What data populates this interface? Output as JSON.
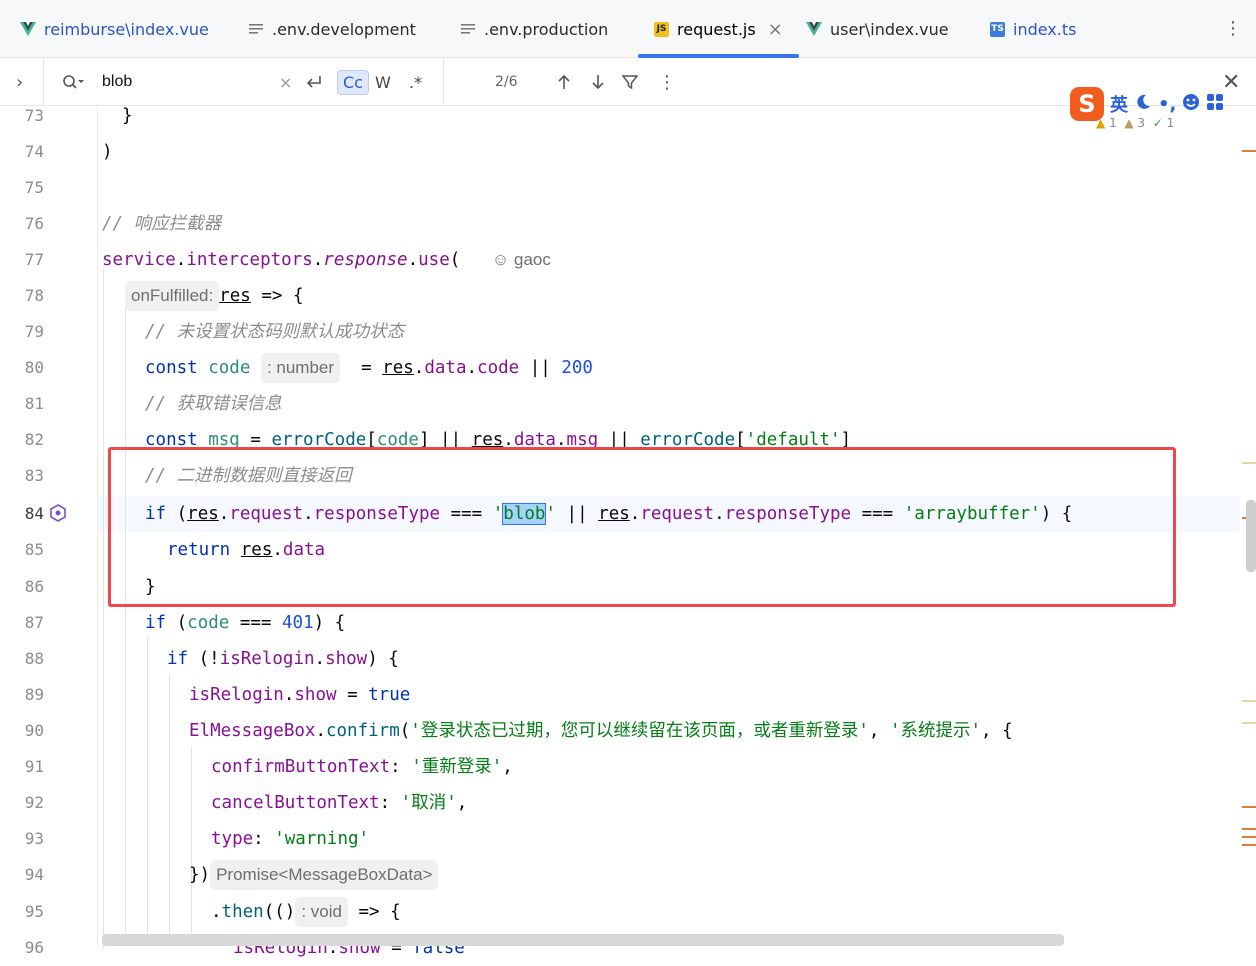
{
  "tabs": [
    {
      "label": "reimburse\\index.vue",
      "icon": "vue-icon",
      "active": false
    },
    {
      "label": ".env.development",
      "icon": "text-file-icon",
      "active": false
    },
    {
      "label": ".env.production",
      "icon": "text-file-icon",
      "active": false
    },
    {
      "label": "request.js",
      "icon": "js-file-icon",
      "active": true
    },
    {
      "label": "user\\index.vue",
      "icon": "vue-icon",
      "active": false
    },
    {
      "label": "index.ts",
      "icon": "ts-file-icon",
      "active": false
    }
  ],
  "js_badge": "JS",
  "ts_badge": "TS",
  "find": {
    "value": "blob",
    "match_count": "2/6",
    "opt_case": "Cc",
    "opt_word": "W",
    "opt_regex": ".*"
  },
  "ime": {
    "logo": "S",
    "mode": "英",
    "symbols": "•,"
  },
  "inspections": {
    "warn": "1",
    "weak": "3",
    "typo": "1"
  },
  "gutter_lines": [
    "73",
    "74",
    "75",
    "76",
    "77",
    "78",
    "79",
    "80",
    "81",
    "82",
    "83",
    "84",
    "85",
    "86",
    "87",
    "88",
    "89",
    "90",
    "91",
    "92",
    "93",
    "94",
    "95",
    "96"
  ],
  "code": {
    "l73": "}",
    "l74": ")",
    "l76": "// 响应拦截器",
    "l77_obj": "service",
    "l77_a": "interceptors",
    "l77_b": "response",
    "l77_c": "use",
    "l77_author": "gaoc",
    "l78_hint": "onFulfilled:",
    "l78_param": "res",
    "l78_arrow": " => {",
    "l79": "// 未设置状态码则默认成功状态",
    "l80_const": "const",
    "l80_var": "code",
    "l80_hint": ": number",
    "l80_res": "res",
    "l80_data": "data",
    "l80_code": "code",
    "l80_num": "200",
    "l81": "// 获取错误信息",
    "l82_const": "const",
    "l82_var": "msg",
    "l82_fn": "errorCode",
    "l82_code": "code",
    "l82_res": "res",
    "l82_data": "data",
    "l82_msg": "msg",
    "l82_fn2": "errorCode",
    "l82_str": "'default'",
    "l83": "// 二进制数据则直接返回",
    "l84_if": "if",
    "l84_res": "res",
    "l84_request": "request",
    "l84_rt": "responseType",
    "l84_q1": "'",
    "l84_blob": "blob",
    "l84_q2": "'",
    "l84_res2": "res",
    "l84_request2": "request",
    "l84_rt2": "responseType",
    "l84_str2": "'arraybuffer'",
    "l85_ret": "return",
    "l85_res": "res",
    "l85_data": "data",
    "l86": "}",
    "l87_if": "if",
    "l87_code": "code",
    "l87_num": "401",
    "l88_if": "if",
    "l88_obj": "isRelogin",
    "l88_show": "show",
    "l89_obj": "isRelogin",
    "l89_show": "show",
    "l89_true": "true",
    "l90_obj": "ElMessageBox",
    "l90_fn": "confirm",
    "l90_str1": "'登录状态已过期，您可以继续留在该页面，或者重新登录'",
    "l90_str2": "'系统提示'",
    "l91_key": "confirmButtonText",
    "l91_str": "'重新登录'",
    "l92_key": "cancelButtonText",
    "l92_str": "'取消'",
    "l93_key": "type",
    "l93_str": "'warning'",
    "l94_close": "})",
    "l94_hint": "Promise<MessageBoxData>",
    "l95_fn": "then",
    "l95_hint": ": void",
    "l95_arrow": " => {",
    "l96_obj": "isRelogin",
    "l96_show": "show",
    "l96_false": "false"
  },
  "colors": {
    "accent": "#3574f0",
    "highlight_box": "#f0474e",
    "keyword": "#0033b3",
    "string": "#067d17",
    "number": "#1750eb",
    "property": "#871094",
    "comment": "#8c8c8c"
  }
}
